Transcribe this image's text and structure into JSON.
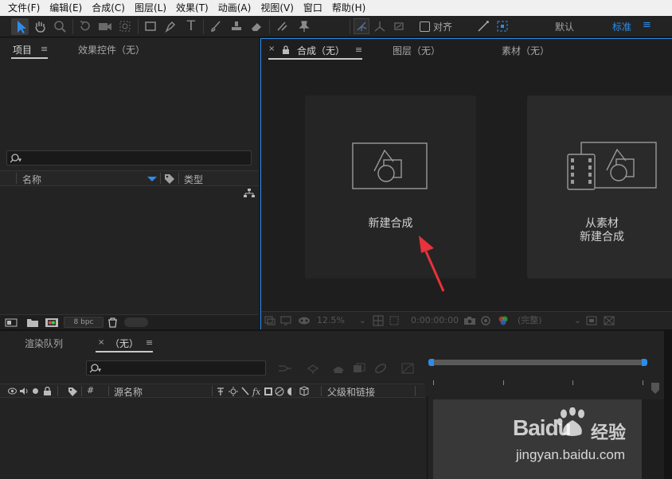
{
  "menu": [
    "文件(F)",
    "编辑(E)",
    "合成(C)",
    "图层(L)",
    "效果(T)",
    "动画(A)",
    "视图(V)",
    "窗口",
    "帮助(H)"
  ],
  "toolbar": {
    "snap_label": "对齐",
    "workspace_default": "默认",
    "workspace_standard": "标准"
  },
  "project_panel": {
    "tab_project": "项目",
    "tab_effects": "效果控件（无）",
    "col_name": "名称",
    "col_type": "类型",
    "bpc": "8 bpc"
  },
  "comp_panel": {
    "tab_comp": "合成（无）",
    "tab_layer": "图层（无）",
    "tab_footage": "素材（无）",
    "new_comp": "新建合成",
    "from_footage_line1": "从素材",
    "from_footage_line2": "新建合成",
    "zoom": "12.5%",
    "timecode": "0:00:00:00",
    "quality": "(完整)"
  },
  "timeline_panel": {
    "tab_render": "渲染队列",
    "tab_none": "（无）",
    "col_hash": "#",
    "col_source": "源名称",
    "col_parent": "父级和链接"
  },
  "watermark": {
    "brand": "Baidu",
    "brand_suffix": "经验",
    "url": "jingyan.baidu.com"
  },
  "colors": {
    "accent": "#2d8ceb",
    "panel_bg": "#232323",
    "arrow": "#e8323c"
  }
}
